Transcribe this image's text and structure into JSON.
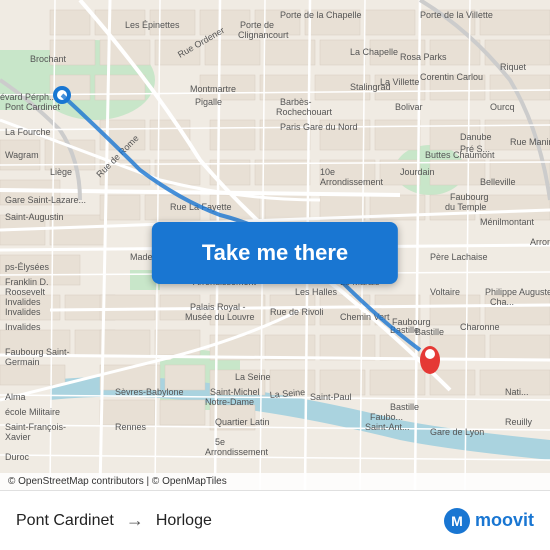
{
  "map": {
    "button_label": "Take me there",
    "attribution": "© OpenStreetMap contributors | © OpenMapTiles",
    "accent_color": "#1976d2",
    "marker_color": "#e53935"
  },
  "bottom_bar": {
    "from": "Pont Cardinet",
    "to": "Horloge",
    "arrow": "→",
    "logo_text": "moovit"
  }
}
